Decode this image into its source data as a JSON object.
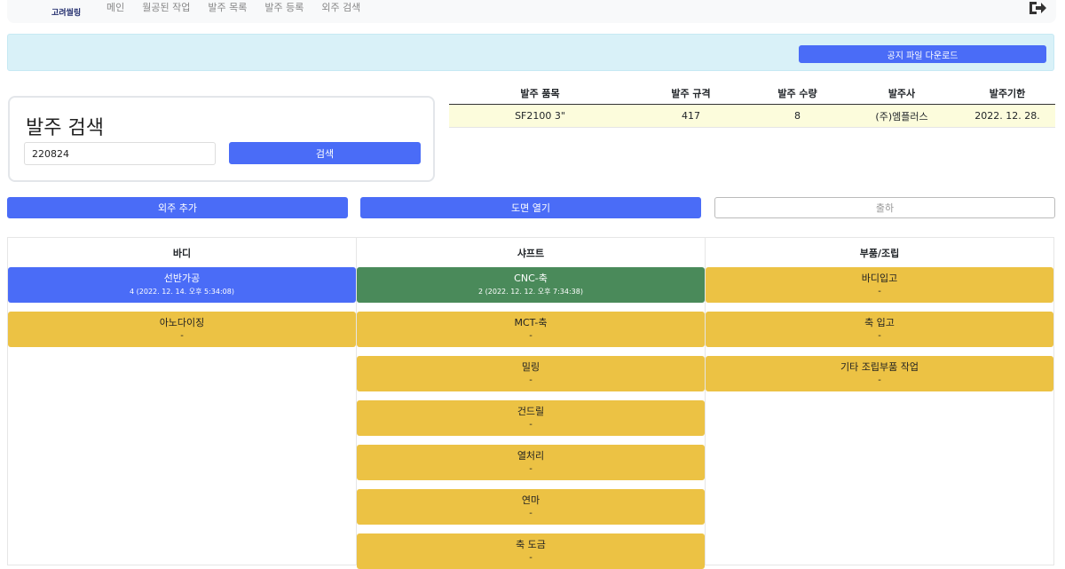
{
  "nav": {
    "logo_text": "고려씰링",
    "items": [
      "메인",
      "월공된 작업",
      "발주 목록",
      "발주 등록",
      "외주 검색"
    ]
  },
  "notice": {
    "download_label": "공지 파일 다운로드"
  },
  "search": {
    "title": "발주 검색",
    "value": "220824",
    "button_label": "검색"
  },
  "order_table": {
    "headers": [
      "발주 품목",
      "발주 규격",
      "발주 수량",
      "발주사",
      "발주기한"
    ],
    "rows": [
      [
        "SF2100 3\"",
        "417",
        "8",
        "(주)엠플러스",
        "2022. 12. 28."
      ]
    ]
  },
  "actions": {
    "add_outsource": "외주 추가",
    "open_drawing": "도면 열기",
    "ship": "출하"
  },
  "columns": [
    {
      "title": "바디",
      "tasks": [
        {
          "name": "선반가공",
          "sub": "4 (2022. 12. 14. 오후 5:34:08)",
          "status": "active"
        },
        {
          "name": "아노다이징",
          "sub": "-",
          "status": "pending"
        }
      ]
    },
    {
      "title": "샤프트",
      "tasks": [
        {
          "name": "CNC-축",
          "sub": "2 (2022. 12. 12. 오후 7:34:38)",
          "status": "done"
        },
        {
          "name": "MCT-축",
          "sub": "-",
          "status": "pending"
        },
        {
          "name": "밀링",
          "sub": "-",
          "status": "pending"
        },
        {
          "name": "건드릴",
          "sub": "-",
          "status": "pending"
        },
        {
          "name": "열처리",
          "sub": "-",
          "status": "pending"
        },
        {
          "name": "연마",
          "sub": "-",
          "status": "pending"
        },
        {
          "name": "축 도금",
          "sub": "-",
          "status": "pending"
        }
      ]
    },
    {
      "title": "부품/조립",
      "tasks": [
        {
          "name": "바디입고",
          "sub": "-",
          "status": "pending"
        },
        {
          "name": "축 입고",
          "sub": "-",
          "status": "pending"
        },
        {
          "name": "기타 조립부품 작업",
          "sub": "-",
          "status": "pending"
        }
      ]
    }
  ],
  "colors": {
    "active": "#4a6cf7",
    "done": "#4a8a5a",
    "pending": "#ecc244",
    "done_text": "#ffffff",
    "active_text": "#ffffff"
  }
}
